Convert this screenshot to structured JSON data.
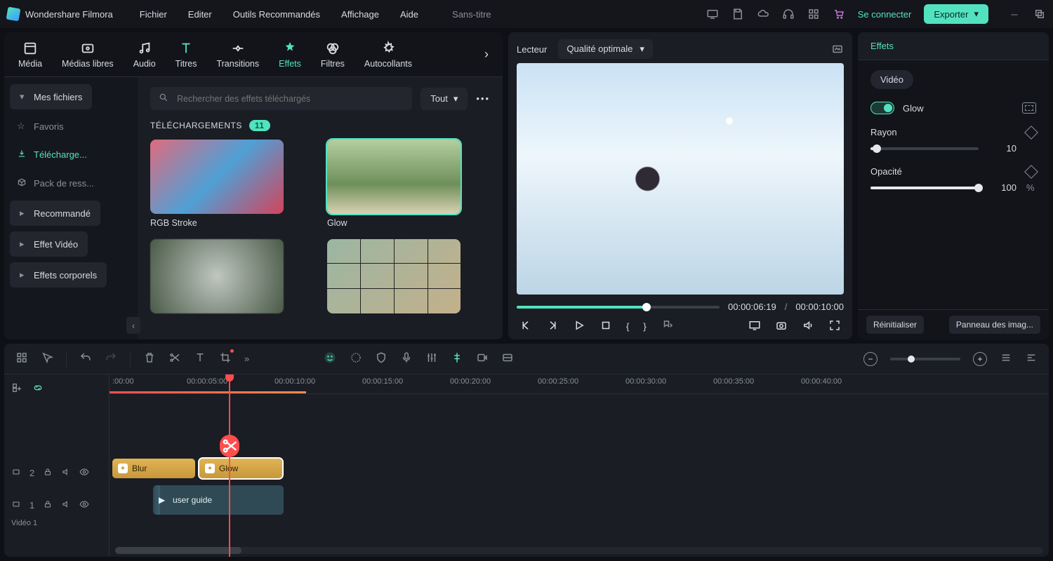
{
  "app_name": "Wondershare Filmora",
  "menu": [
    "Fichier",
    "Editer",
    "Outils Recommandés",
    "Affichage",
    "Aide"
  ],
  "project_title": "Sans-titre",
  "header": {
    "login": "Se connecter",
    "export": "Exporter"
  },
  "tabs": {
    "items": [
      "Média",
      "Médias libres",
      "Audio",
      "Titres",
      "Transitions",
      "Effets",
      "Filtres",
      "Autocollants"
    ],
    "active": "Effets"
  },
  "sidebar": {
    "items": [
      {
        "label": "Mes fichiers",
        "type": "chip"
      },
      {
        "label": "Favoris",
        "icon": "star"
      },
      {
        "label": "Télécharge...",
        "icon": "download",
        "active": true
      },
      {
        "label": "Pack de ress...",
        "icon": "package"
      },
      {
        "label": "Recommandé",
        "type": "chip"
      },
      {
        "label": "Effet Vidéo",
        "type": "chip"
      },
      {
        "label": "Effets corporels",
        "type": "chip"
      }
    ]
  },
  "content": {
    "search_placeholder": "Rechercher des effets téléchargés",
    "filter": "Tout",
    "section_title": "Téléchargements",
    "badge": "11",
    "cards": [
      {
        "label": "RGB Stroke",
        "cls": "rgb"
      },
      {
        "label": "Glow",
        "cls": "glow",
        "selected": true
      },
      {
        "label": "",
        "cls": "blur"
      },
      {
        "label": "",
        "cls": "tv"
      }
    ]
  },
  "preview": {
    "title": "Lecteur",
    "quality": "Qualité optimale",
    "time_current": "00:00:06:19",
    "time_total": "00:00:10:00"
  },
  "properties": {
    "tab": "Effets",
    "chip": "Vidéo",
    "effect_name": "Glow",
    "params": [
      {
        "name": "Rayon",
        "value": "10",
        "percent": 6
      },
      {
        "name": "Opacité",
        "value": "100",
        "unit": "%",
        "percent": 100
      }
    ],
    "reset": "Réinitialiser",
    "panel": "Panneau des imag..."
  },
  "timeline": {
    "ruler": [
      ":00:00",
      "00:00:05:00",
      "00:00:10:00",
      "00:00:15:00",
      "00:00:20:00",
      "00:00:25:00",
      "00:00:30:00",
      "00:00:35:00",
      "00:00:40:00"
    ],
    "tracks": {
      "fx_number": "2",
      "video_number": "1",
      "video_label": "Vidéo 1"
    },
    "clips": {
      "blur": "Blur",
      "glow": "Glow",
      "video": "user guide"
    }
  }
}
